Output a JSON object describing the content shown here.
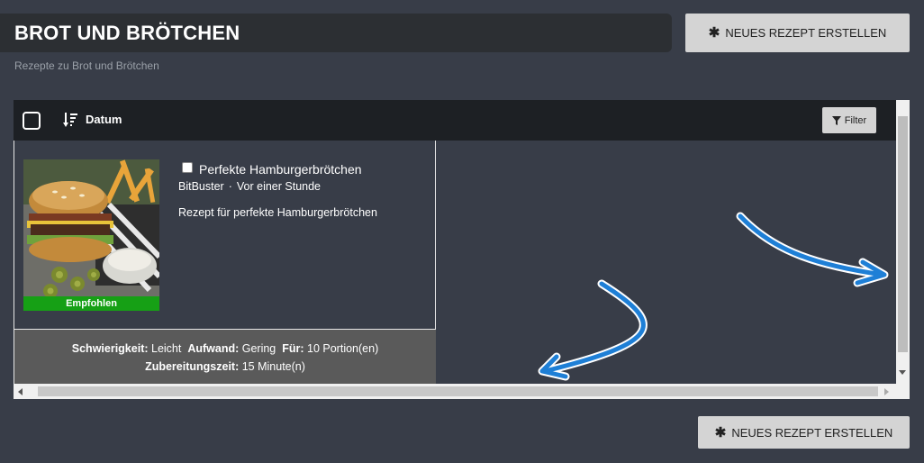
{
  "header": {
    "title": "BROT UND BRÖTCHEN",
    "subtitle": "Rezepte zu Brot und Brötchen",
    "new_recipe_label": "NEUES REZEPT ERSTELLEN"
  },
  "toolbar": {
    "sort_label": "Datum",
    "filter_label": "Filter"
  },
  "recipe": {
    "title": "Perfekte Hamburgerbrötchen",
    "author": "BitBuster",
    "separator": "·",
    "time": "Vor einer Stunde",
    "description": "Rezept für perfekte Hamburgerbrötchen",
    "badge": "Empfohlen",
    "difficulty_label": "Schwierigkeit:",
    "difficulty_value": "Leicht",
    "effort_label": "Aufwand:",
    "effort_value": "Gering",
    "for_label": "Für:",
    "for_value": "10 Portion(en)",
    "prep_label": "Zubereitungszeit:",
    "prep_value": "15 Minute(n)"
  },
  "footer": {
    "new_recipe_label": "NEUES REZEPT ERSTELLEN"
  },
  "colors": {
    "background": "#383d48",
    "badge": "#16a015",
    "arrow": "#1e7fd6"
  }
}
